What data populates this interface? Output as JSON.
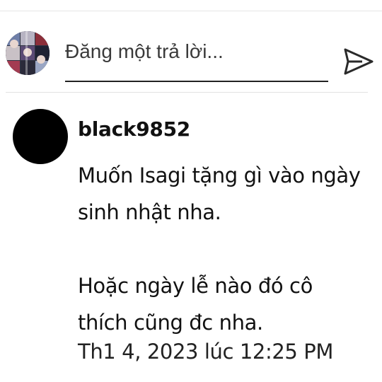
{
  "reply_bar": {
    "placeholder": "Đăng một trả lời...",
    "send_icon": "send-icon",
    "avatar_icon": "profile-avatar"
  },
  "comment": {
    "username": "black9852",
    "body": "Muốn Isagi tặng gì vào ngày\nsinh nhật nha.\n\nHoặc ngày lễ nào đó cô\nthích cũng đc nha.",
    "timestamp": "Th1 4, 2023 lúc 12:25 PM",
    "avatar_color": "#000000"
  }
}
